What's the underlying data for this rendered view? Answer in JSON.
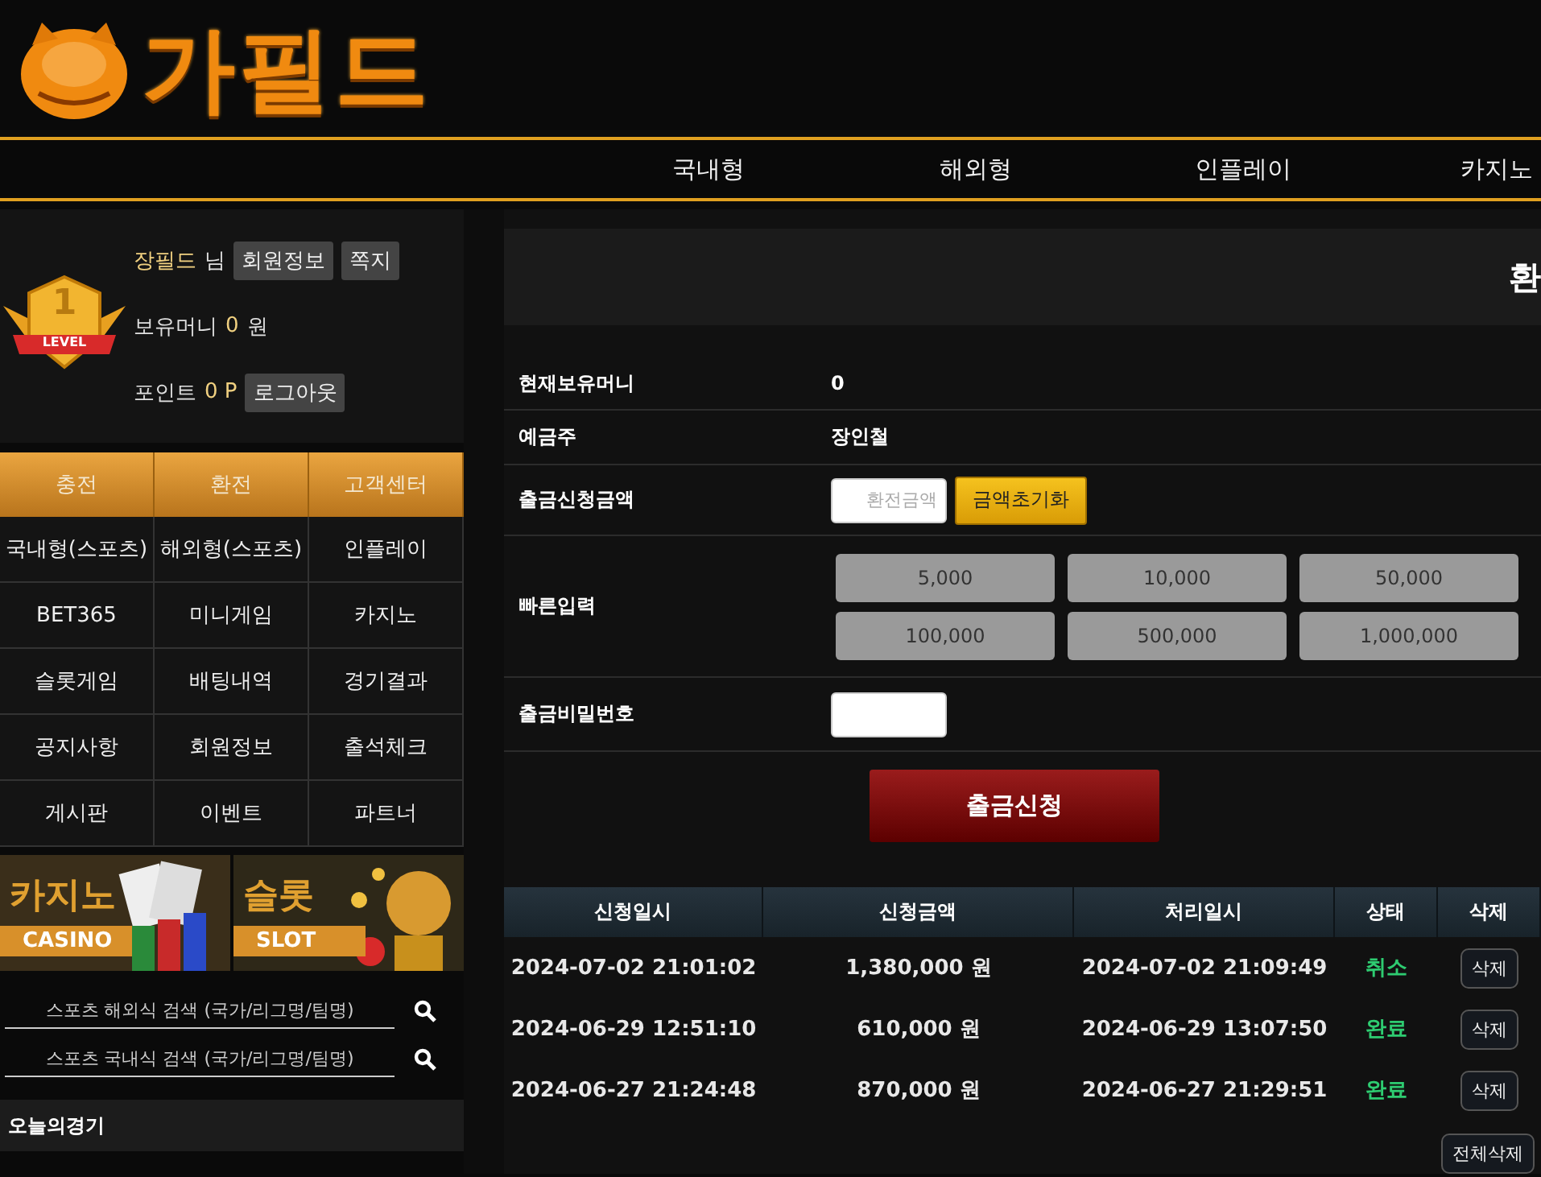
{
  "logo": {
    "text": "가필드"
  },
  "nav": [
    "국내형",
    "해외형",
    "인플레이",
    "카지노"
  ],
  "user": {
    "badge": {
      "number": "1",
      "label": "LEVEL"
    },
    "name": "장필드",
    "honorific": "님",
    "buttons": [
      "회원정보",
      "쪽지"
    ],
    "money_label": "보유머니",
    "money": "0",
    "money_unit": "원",
    "point_label": "포인트",
    "point": "0 P",
    "logout": "로그아웃"
  },
  "menu": {
    "header": [
      "충전",
      "환전",
      "고객센터"
    ],
    "items": [
      "국내형(스포츠)",
      "해외형(스포츠)",
      "인플레이",
      "BET365",
      "미니게임",
      "카지노",
      "슬롯게임",
      "배팅내역",
      "경기결과",
      "공지사항",
      "회원정보",
      "출석체크",
      "게시판",
      "이벤트",
      "파트너"
    ]
  },
  "banners": [
    {
      "kind": "casino",
      "title": "카지노",
      "subtitle": "CASINO"
    },
    {
      "kind": "slot",
      "title": "슬롯",
      "subtitle": "SLOT"
    }
  ],
  "searches": [
    {
      "placeholder": "스포츠 해외식 검색 (국가/리그명/팀명)"
    },
    {
      "placeholder": "스포츠 국내식 검색 (국가/리그명/팀명)"
    }
  ],
  "today": {
    "title": "오늘의경기"
  },
  "page": {
    "title": "환"
  },
  "form": [
    {
      "kind": "text",
      "label": "현재보유머니",
      "value": "0"
    },
    {
      "kind": "text",
      "label": "예금주",
      "value": "장인철"
    },
    {
      "kind": "amount",
      "label": "출금신청금액",
      "placeholder": "환전금액",
      "button": "금액초기화"
    },
    {
      "kind": "quick",
      "label": "빠른입력",
      "options": [
        "5,000",
        "10,000",
        "50,000",
        "100,000",
        "500,000",
        "1,000,000"
      ]
    },
    {
      "kind": "password",
      "label": "출금비밀번호"
    }
  ],
  "submit": "출금신청",
  "table": {
    "columns": [
      "신청일시",
      "신청금액",
      "처리일시",
      "상태",
      "삭제"
    ],
    "rows": [
      {
        "requested": "2024-07-02 21:01:02",
        "amount": "1,380,000 원",
        "processed": "2024-07-02 21:09:49",
        "status": "취소",
        "delete": "삭제"
      },
      {
        "requested": "2024-06-29 12:51:10",
        "amount": "610,000 원",
        "processed": "2024-06-29 13:07:50",
        "status": "완료",
        "delete": "삭제"
      },
      {
        "requested": "2024-06-27 21:24:48",
        "amount": "870,000 원",
        "processed": "2024-06-27 21:29:51",
        "status": "완료",
        "delete": "삭제"
      }
    ]
  },
  "delete_all": "전체삭제"
}
